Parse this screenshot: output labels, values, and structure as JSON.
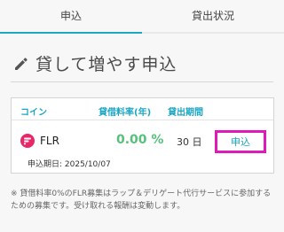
{
  "tabs": [
    {
      "label": "申込",
      "active": true
    },
    {
      "label": "貸出状況",
      "active": false
    }
  ],
  "page": {
    "title": "貸して増やす申込",
    "icon": "pencil-icon"
  },
  "table": {
    "headers": {
      "coin": "コイン",
      "rate": "貸借料率(年)",
      "period": "貸出期間"
    },
    "row": {
      "coin_icon": "flr-logo-icon",
      "coin": "FLR",
      "rate": "0.00 %",
      "period": "30 日",
      "apply_label": "申込",
      "deadline": "申込期日: 2025/10/07"
    }
  },
  "note": "※ 貸借料率0%のFLR募集はラップ＆デリゲート代行サービスに参加するための募集です。受け取れる報酬は変動します。",
  "colors": {
    "accent": "#1aa6c4",
    "rate_green": "#57c07a",
    "highlight": "#e01ab9",
    "flr_logo": "#e8276a"
  }
}
